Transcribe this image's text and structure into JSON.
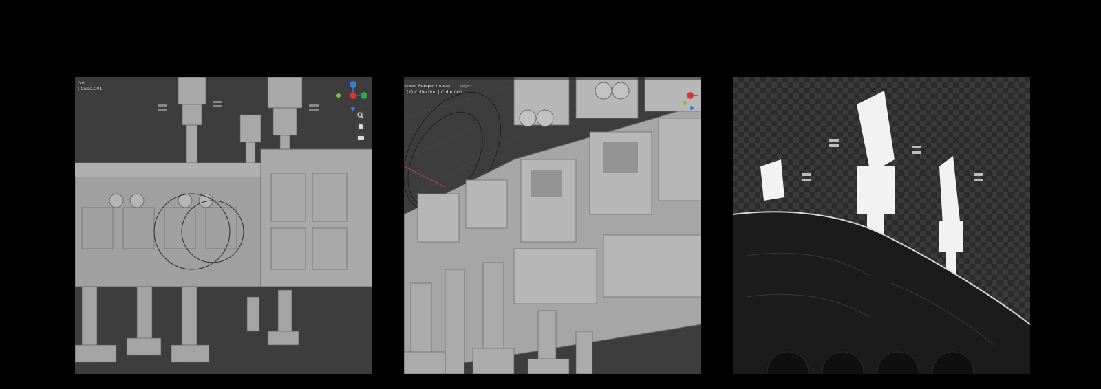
{
  "panels": [
    {
      "id": "solid-viewport-front",
      "viewport": {
        "mode_text": "ive",
        "object_text": "| Cube.001"
      },
      "colors": {
        "background": "#3d3d3d",
        "model": "#9c9c9c"
      },
      "gizmo": {
        "axes": [
          "Z",
          "Y",
          "X"
        ]
      },
      "nav_icons": [
        "zoom-icon",
        "pan-hand-icon",
        "camera-icon"
      ]
    },
    {
      "id": "solid-viewport-perspective",
      "viewport": {
        "mode_text": "User Perspective",
        "object_text": "(2) Collection | Cube.001",
        "menu": [
          "View",
          "Select",
          "Add",
          "Object"
        ]
      },
      "colors": {
        "background": "#3d3d3d",
        "model": "#a6a6a6"
      },
      "gizmo": {
        "axes": [
          "Z",
          "Y",
          "X"
        ]
      }
    },
    {
      "id": "rendered-preview",
      "colors": {
        "background": "#2b2b2b",
        "checker": "#3a3a3a",
        "model": "#ffffff"
      }
    }
  ]
}
